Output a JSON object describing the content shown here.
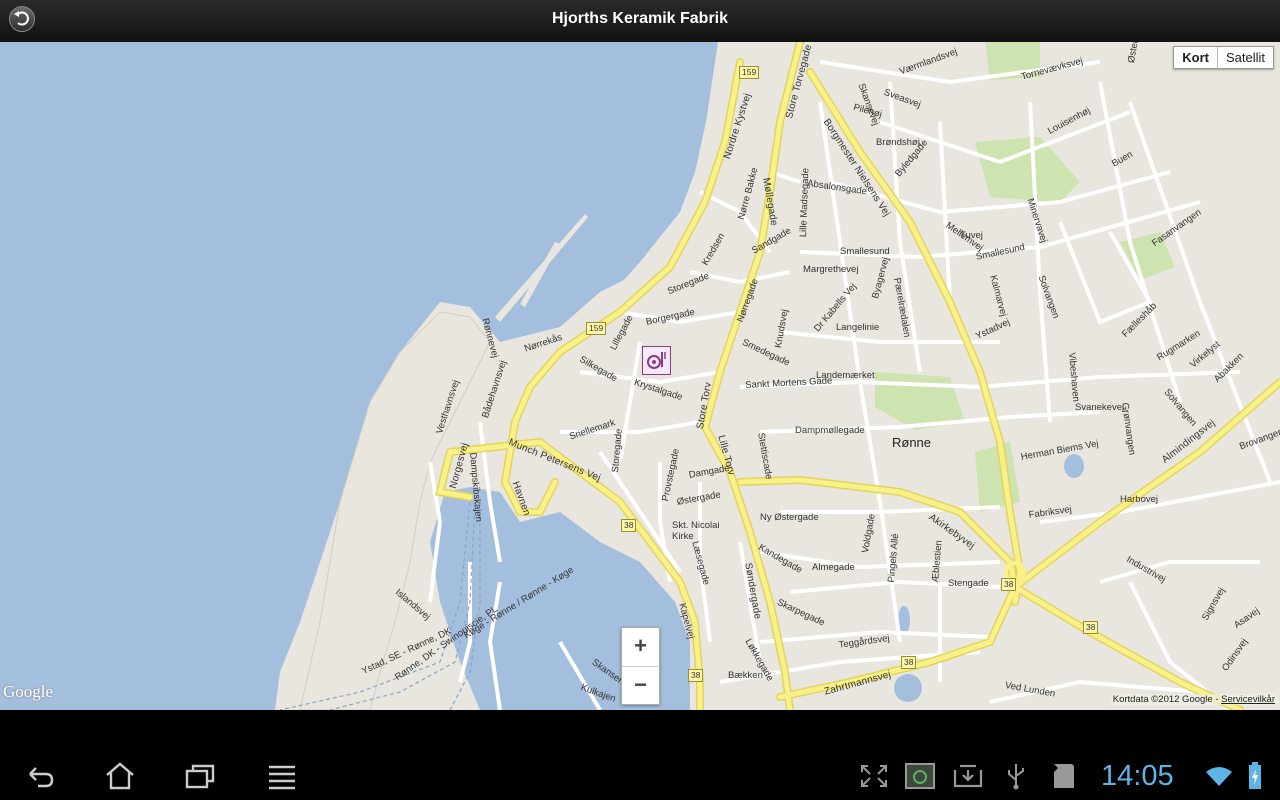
{
  "app": {
    "title": "Hjorths Keramik Fabrik"
  },
  "map": {
    "type_buttons": [
      "Kort",
      "Satellit"
    ],
    "active_type": "Kort",
    "zoom_in": "+",
    "zoom_out": "−",
    "logo": "Google",
    "attribution": "Kortdata ©2012 Google - ",
    "terms": "Servicevilkår",
    "city": "Rønne",
    "poi_name": "Hjorths Keramik Fabrik",
    "poi_icon": "restaurant-pottery-icon",
    "street_labels": [
      "Nordre Kystvej",
      "Store Torvegade",
      "Borgmester Nielsens Vej",
      "Møllegade",
      "Storegade",
      "Borgergade",
      "Lillegade",
      "Silkegade",
      "Krystalgade",
      "Snellemark",
      "Storegade",
      "Munch Petersens Vej",
      "Havnen",
      "Norgesvej",
      "Dampskibskajen",
      "Vesthavnsvej",
      "Bådehavnsvej",
      "Rønnevej",
      "Nørrekås",
      "Provstegade",
      "Damgade",
      "Østergade",
      "Skt. Nicolai Kirke",
      "Store Torv",
      "Lille Torv",
      "Sankt Mortens Gade",
      "Dampmøllegade",
      "Landemærket",
      "Smedegade",
      "Langelinie",
      "Smallesund",
      "Søndergade",
      "Kapelvej",
      "Zahrtmannsvej",
      "Akirkebyvej",
      "Almindingsvej",
      "Svanekevej",
      "Herman Biems Vej",
      "Fabriksvej",
      "Stengade",
      "Almegade",
      "Teggårdsvej",
      "Ny Østergade",
      "Kandegade",
      "Skarpegade",
      "Læsegade",
      "Sandgade",
      "Nørregade",
      "Absalonsgade",
      "Byledgade",
      "Pilehøj",
      "Sveasvej",
      "Brøndshøj",
      "Østerled",
      "Tornevævksvej",
      "Louisenhøj",
      "Buen",
      "Fasanvangen",
      "Smallesund",
      "Kalmarvej",
      "Solvangen",
      "Minervavej",
      "Solvangen",
      "Fælleshåb",
      "Rugmarken",
      "Virkelyst",
      "Abakken",
      "Grønvangen",
      "Harbovej",
      "Industrivej",
      "Signsvej",
      "Asavej",
      "Odinsvej",
      "Pingels Allé",
      "Æblestien",
      "Voldgade",
      "Ved Lunden",
      "Løkkegade",
      "Bækken",
      "Kulkajen",
      "Skansen",
      "Islandsvej",
      "Ystad, SE - Rønne, DK",
      "Køge - Rønne / Rønne - Køge",
      "Rønne, DK - Swinoujscie, PL",
      "Margrethevej",
      "Byagervej",
      "Dr Kabells Vej",
      "Lille Madsegade",
      "Knudsvej",
      "Stettiscade",
      "Mellemvej",
      "Ystadvej",
      "Tuvej",
      "Pærelrædalen",
      "Nørre Bakke",
      "Kredsen",
      "Værmlandsvej",
      "Skansevej",
      "Brovangen",
      "Vibeshaven"
    ],
    "route_badges": [
      "159",
      "159",
      "38",
      "38",
      "38",
      "38",
      "38"
    ]
  },
  "system_bar": {
    "time": "14:05",
    "icons": [
      "back-icon",
      "home-icon",
      "recent-apps-icon",
      "menu-icon",
      "fullscreen-icon",
      "screenshot-icon",
      "download-icon",
      "usb-icon",
      "sd-card-icon",
      "wifi-icon",
      "battery-charging-icon"
    ]
  },
  "colors": {
    "water": "#a4bedd",
    "land": "#e8e6de",
    "road_major": "#f8f18a",
    "park": "#cde3b0",
    "clock": "#5fb4e6"
  }
}
